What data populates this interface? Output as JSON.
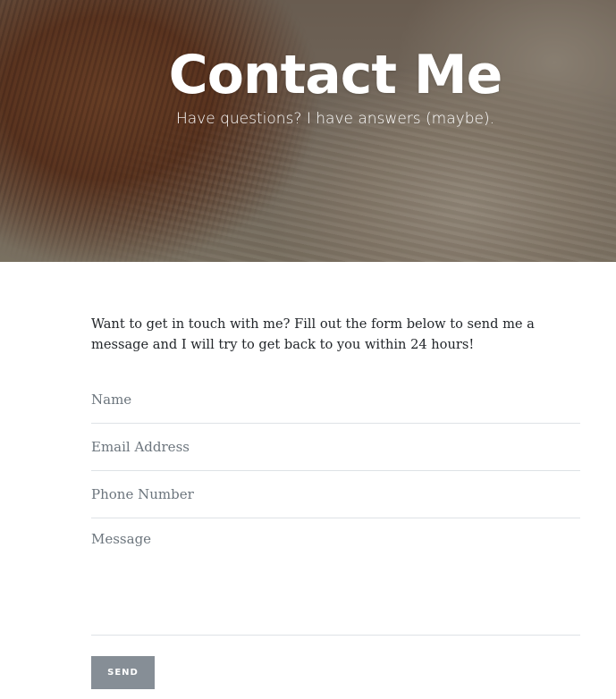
{
  "header": {
    "title": "Contact Me",
    "subtitle": "Have questions? I have answers (maybe)."
  },
  "intro": {
    "text": "Want to get in touch with me? Fill out the form below to send me a message and I will try to get back to you within 24 hours!"
  },
  "form": {
    "name_placeholder": "Name",
    "email_placeholder": "Email Address",
    "phone_placeholder": "Phone Number",
    "message_placeholder": "Message",
    "send_label": "Send"
  },
  "colors": {
    "button": "#868e96",
    "text": "#212529",
    "placeholder": "#6c757d",
    "divider": "#dee2e6"
  }
}
